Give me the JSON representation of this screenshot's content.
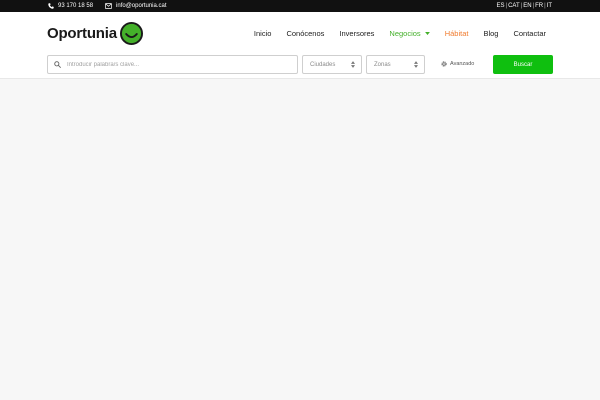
{
  "topbar": {
    "phone": "93 170 18 58",
    "email": "info@oportunia.cat",
    "languages": [
      "ES",
      "CAT",
      "EN",
      "FR",
      "IT"
    ],
    "separator": "|"
  },
  "header": {
    "logo_text": "Oportunia",
    "nav": [
      {
        "label": "Inicio"
      },
      {
        "label": "Conócenos"
      },
      {
        "label": "Inversores"
      },
      {
        "label": "Negocios"
      },
      {
        "label": "Hábitat"
      },
      {
        "label": "Blog"
      },
      {
        "label": "Contactar"
      }
    ]
  },
  "search": {
    "keyword_placeholder": "Introducir palabra/s clave...",
    "cities_value": "Ciudades",
    "zones_value": "Zonas",
    "advanced_label": "Avanzado",
    "submit_label": "Buscar"
  },
  "colors": {
    "brand_green": "#44b02a",
    "button_green": "#0fbf0f",
    "habitat_orange": "#f07b2e",
    "topbar_bg": "#111111"
  },
  "icons": [
    "phone-icon",
    "envelope-icon",
    "smiley-logo-icon",
    "search-icon",
    "sort-arrows-icon",
    "gear-icon",
    "chevron-down-icon"
  ]
}
